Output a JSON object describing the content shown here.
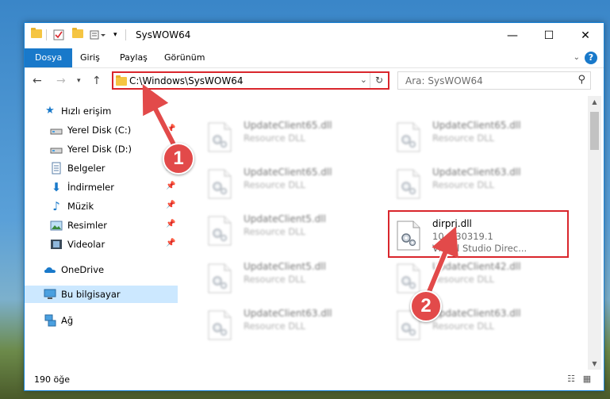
{
  "window": {
    "title": "SysWOW64",
    "minimize": "—",
    "maximize": "☐",
    "close": "✕"
  },
  "ribbon": {
    "tabs": [
      "Dosya",
      "Giriş",
      "Paylaş",
      "Görünüm"
    ],
    "help": "?"
  },
  "addressbar": {
    "path": "C:\\Windows\\SysWOW64",
    "search_placeholder": "Ara: SysWOW64"
  },
  "navpane": {
    "items": [
      {
        "label": "Hızlı erişim",
        "icon": "star-icon"
      },
      {
        "label": "Yerel Disk (C:)",
        "icon": "drive-icon"
      },
      {
        "label": "Yerel Disk (D:)",
        "icon": "drive-icon"
      },
      {
        "label": "Belgeler",
        "icon": "documents-icon"
      },
      {
        "label": "İndirmeler",
        "icon": "download-icon"
      },
      {
        "label": "Müzik",
        "icon": "music-icon"
      },
      {
        "label": "Resimler",
        "icon": "pictures-icon"
      },
      {
        "label": "Videolar",
        "icon": "video-icon"
      },
      {
        "label": "OneDrive",
        "icon": "cloud-icon"
      },
      {
        "label": "Bu bilgisayar",
        "icon": "computer-icon"
      },
      {
        "label": "Ağ",
        "icon": "network-icon"
      }
    ]
  },
  "files": [
    {
      "name": "UpdateClient65.dll",
      "line1": "Resource DLL",
      "line2": ""
    },
    {
      "name": "UpdateClient65.dll",
      "line1": "Resource DLL",
      "line2": ""
    },
    {
      "name": "UpdateClient65.dll",
      "line1": "Resource DLL",
      "line2": ""
    },
    {
      "name": "UpdateClient63.dll",
      "line1": "Resource DLL",
      "line2": ""
    },
    {
      "name": "UpdateClient5.dll",
      "line1": "Resource DLL",
      "line2": ""
    },
    {
      "name": "dirprj.dll",
      "line1": "10.0.30319.1",
      "line2": "Visual Studio Direc..."
    },
    {
      "name": "UpdateClient5.dll",
      "line1": "Resource DLL",
      "line2": ""
    },
    {
      "name": "UpdateClient42.dll",
      "line1": "Resource DLL",
      "line2": ""
    },
    {
      "name": "UpdateClient63.dll",
      "line1": "Resource DLL",
      "line2": ""
    },
    {
      "name": "UpdateClient63.dll",
      "line1": "Resource DLL",
      "line2": ""
    }
  ],
  "status": {
    "count": "190 öğe"
  },
  "callouts": [
    "1",
    "2"
  ],
  "colors": {
    "accent": "#1979ca",
    "highlight": "#d9262c",
    "callout": "#e24a4a",
    "selected": "#cce8ff"
  }
}
